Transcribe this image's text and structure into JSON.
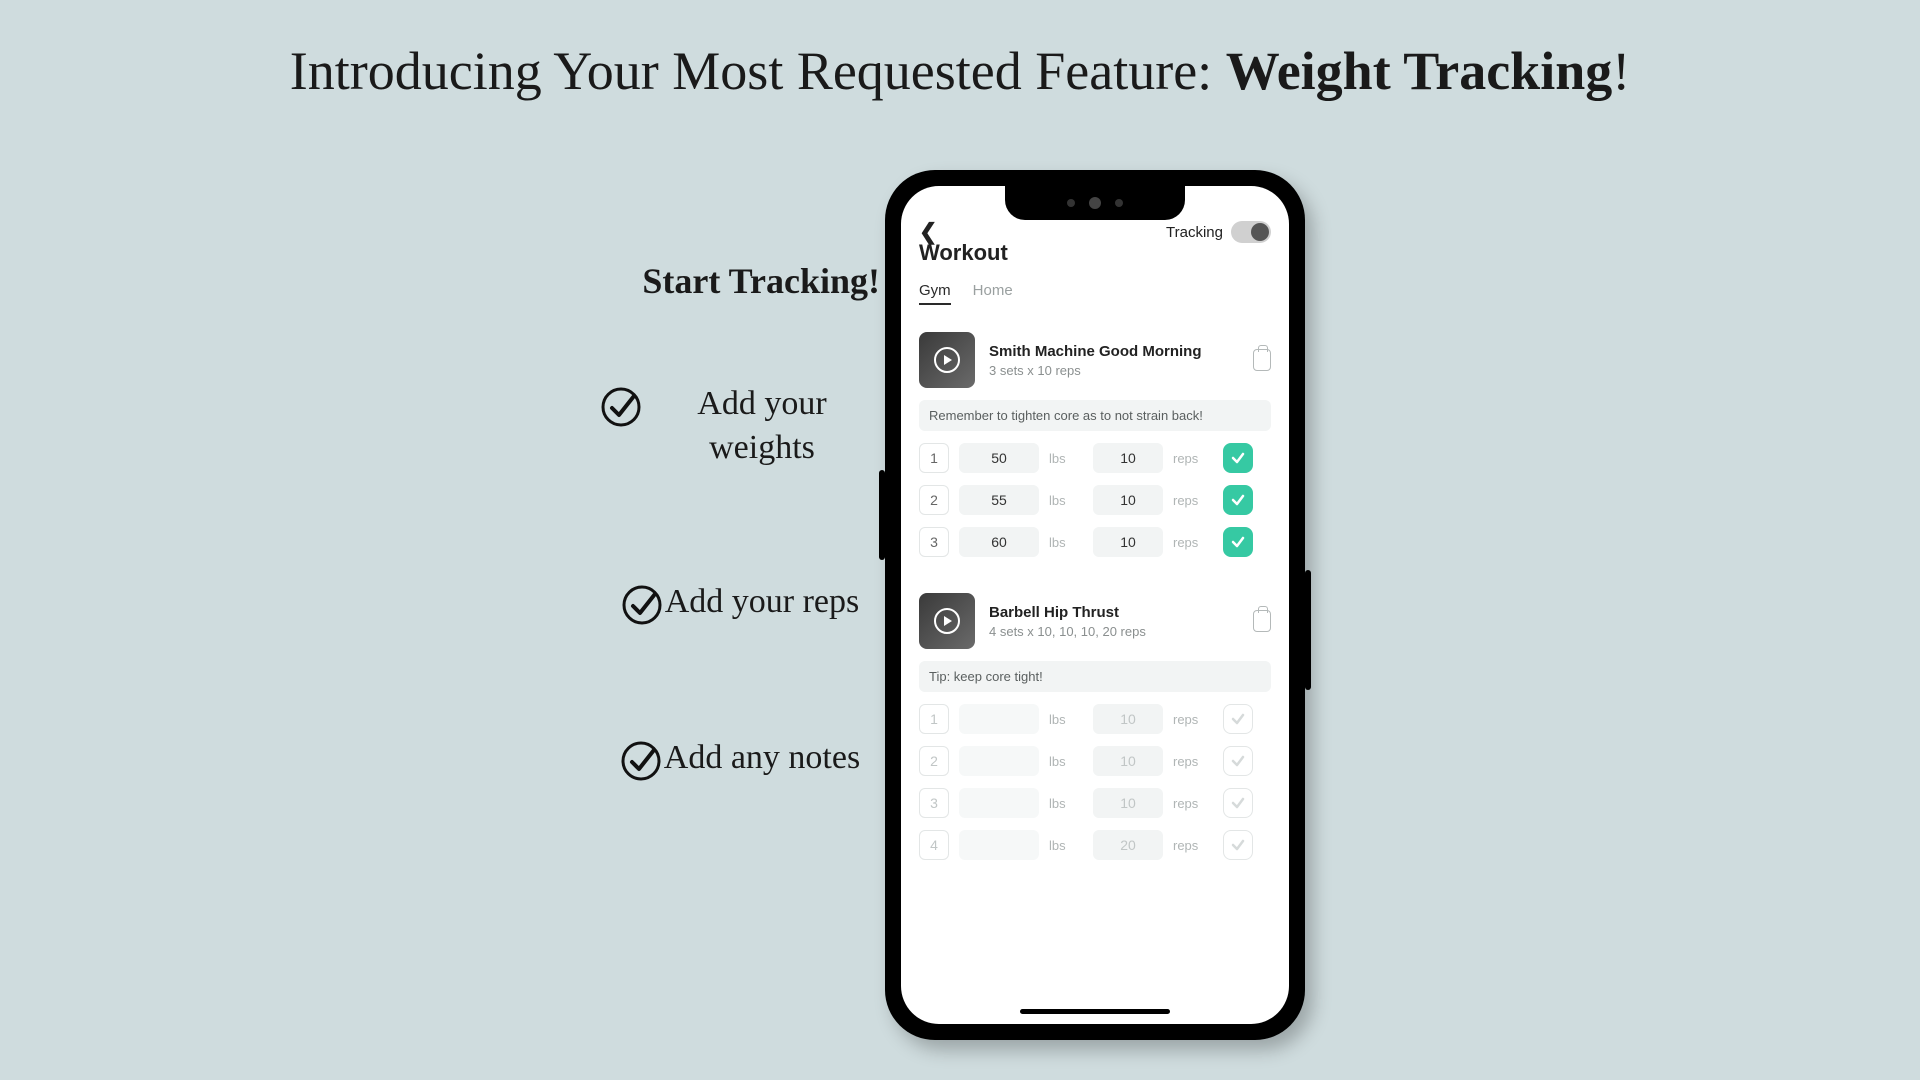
{
  "headline_prefix": "Introducing Your Most Requested Feature: ",
  "headline_bold": "Weight Tracking",
  "headline_suffix": "!",
  "subhead": "Start Tracking!",
  "bullets": [
    "Add your weights",
    "Add your reps",
    "Add any notes"
  ],
  "app": {
    "screen_title": "Workout",
    "tracking_label": "Tracking",
    "tabs": {
      "gym": "Gym",
      "home": "Home"
    },
    "units": {
      "lbs": "lbs",
      "reps": "reps"
    },
    "exercises": [
      {
        "name": "Smith Machine Good Morning",
        "meta": "3 sets x 10 reps",
        "note": "Remember to tighten core as to not strain back!",
        "sets": [
          {
            "idx": "1",
            "weight": "50",
            "reps": "10",
            "done": true
          },
          {
            "idx": "2",
            "weight": "55",
            "reps": "10",
            "done": true
          },
          {
            "idx": "3",
            "weight": "60",
            "reps": "10",
            "done": true
          }
        ]
      },
      {
        "name": "Barbell Hip Thrust",
        "meta": "4 sets x 10, 10, 10, 20 reps",
        "note": "Tip: keep core tight!",
        "sets": [
          {
            "idx": "1",
            "weight": "",
            "reps": "10",
            "done": false
          },
          {
            "idx": "2",
            "weight": "",
            "reps": "10",
            "done": false
          },
          {
            "idx": "3",
            "weight": "",
            "reps": "10",
            "done": false
          },
          {
            "idx": "4",
            "weight": "",
            "reps": "20",
            "done": false
          }
        ]
      }
    ]
  }
}
